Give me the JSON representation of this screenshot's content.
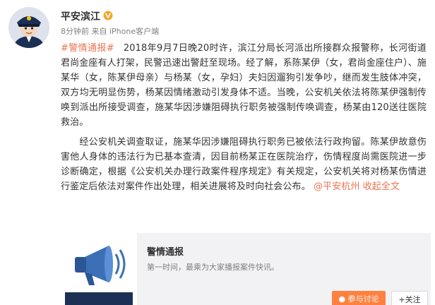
{
  "post": {
    "author": "平安滨江",
    "meta": "8分钟前 来自 iPhone客户端",
    "hashtag": "#警情通报#",
    "paragraph1": "2018年9月7日晚20时许，滨江分局长河派出所接群众报警称，长河街道君尚金座有人打架，民警迅速出警赶至现场。经了解，系陈某伊（女，君尚金座住户）、施某华（女，陈某伊母亲）与杨某（女，孕妇）夫妇因遛狗引发争吵，继而发生肢体冲突，双方均无明显伤势，杨某因情绪激动引发身体不适。当晚，公安机关依法将陈某伊强制传唤到派出所接受调查，施某华因涉嫌阻碍执行职务被强制传唤调查，杨某由120送往医院救治。",
    "paragraph2": "经公安机关调查取证，施某华因涉嫌阻碍执行职务已被依法行政拘留。陈某伊故意伤害他人身体的违法行为已基本查清，因目前杨某正在医院治疗，伤情程度尚需医院进一步诊断确定，根据《公安机关办理行政案件程序规定》有关规定，公安机关将对杨某伤情进行鉴定后依法对案件作出处理，相关进展将及时向社会公布。",
    "mention": "@平安杭州",
    "expand_label": "收起全文"
  },
  "card": {
    "title": "警情通报",
    "description": "第一时间，最乘为大家播报案件快讯。",
    "thumb_text": "警情通报",
    "discuss_label": "参与讨论",
    "follow_label": "关注"
  },
  "colors": {
    "accent": "#eb7350",
    "verified": "#f5a623",
    "discuss_button": "#ff8140"
  },
  "icons": [
    "police-avatar",
    "verified-icon",
    "megaphone-icon",
    "discuss-icon",
    "plus-icon"
  ]
}
